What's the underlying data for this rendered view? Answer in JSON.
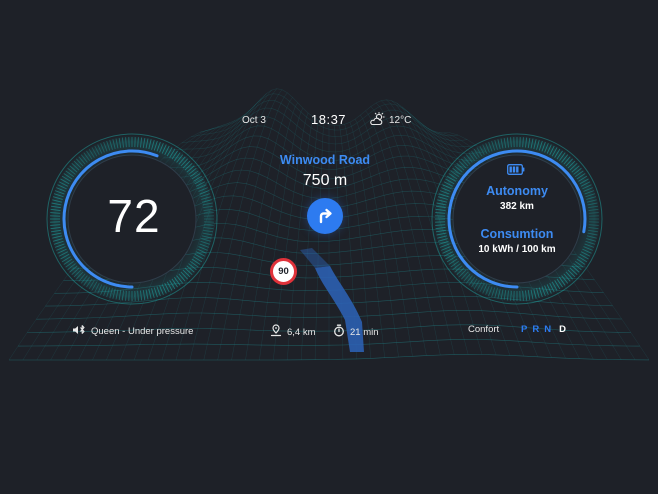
{
  "status": {
    "date": "Oct 3",
    "time": "18:37",
    "weather_icon": "partly-cloudy-icon",
    "temperature": "12°C"
  },
  "navigation": {
    "street": "Winwood Road",
    "distance": "750 m",
    "turn_icon": "turn-right-arrow-icon",
    "speed_limit": "90"
  },
  "speedometer": {
    "value": "72",
    "progress": 0.56
  },
  "energy": {
    "battery_icon": "battery-icon",
    "autonomy_label": "Autonomy",
    "autonomy_value": "382 km",
    "consumption_label": "Consumtion",
    "consumption_value": "10 kWh / 100 km",
    "progress": 0.78
  },
  "bottom_bar": {
    "music_icon": "bluetooth-audio-icon",
    "track": "Queen - Under pressure",
    "route_icon": "route-pin-icon",
    "route_distance": "6,4 km",
    "timer_icon": "stopwatch-icon",
    "route_time": "21 min",
    "drive_mode": "Confort",
    "gears": [
      "P",
      "R",
      "N",
      "D"
    ],
    "active_gear": "D"
  },
  "colors": {
    "background": "#1e2128",
    "accent_blue": "#3d8bf2",
    "teal_glow": "#1fb3b0",
    "inactive_gear": "#2d7bf0",
    "limit_red": "#e0323a"
  }
}
